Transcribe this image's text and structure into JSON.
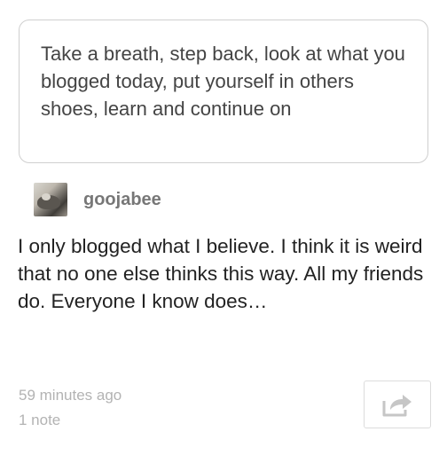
{
  "quote": {
    "text": "Take a breath, step back, look at what you blogged today, put yourself in others shoes, learn and continue on"
  },
  "post": {
    "username": "goojabee",
    "avatar_icon": "user-avatar",
    "body": "I only blogged what I believe. I think it is weird that no one else thinks this way. All my friends do. Everyone I know does…"
  },
  "meta": {
    "timestamp": "59 minutes ago",
    "notes": "1 note"
  },
  "actions": {
    "share_icon": "share-arrow-icon"
  },
  "colors": {
    "border": "#cfcfcf",
    "meta_text": "#b3b3b3",
    "icon": "#c6c6c6"
  }
}
